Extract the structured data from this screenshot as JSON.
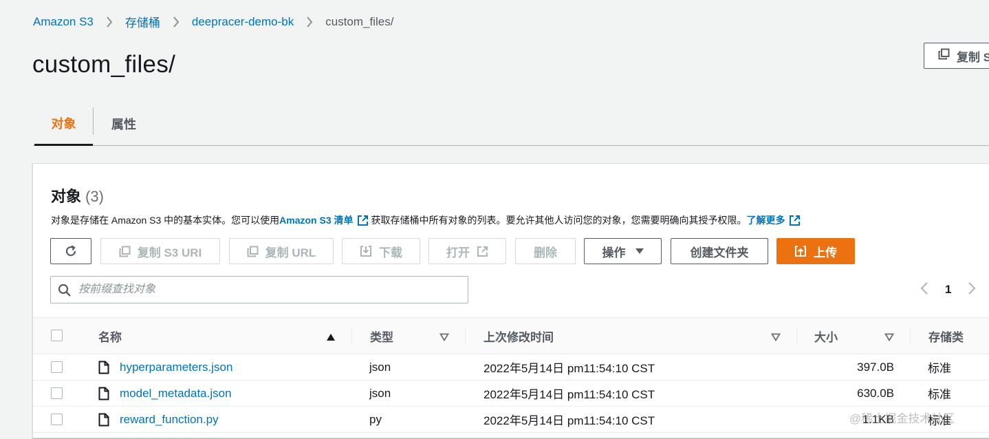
{
  "breadcrumb": {
    "items": [
      "Amazon S3",
      "存储桶",
      "deepracer-demo-bk"
    ],
    "current": "custom_files/"
  },
  "page": {
    "title": "custom_files/",
    "copy_button": "复制 S"
  },
  "tabs": [
    {
      "label": "对象",
      "active": true
    },
    {
      "label": "属性",
      "active": false
    }
  ],
  "panel": {
    "title": "对象",
    "count": "(3)",
    "desc_prefix": "对象是存储在 Amazon S3 中的基本实体。您可以使用 ",
    "desc_link": "Amazon S3 清单",
    "desc_middle": "获取存储桶中所有对象的列表。要允许其他人访问您的对象，您需要明确向其授予权限。",
    "desc_learn_more": "了解更多"
  },
  "toolbar": {
    "refresh_icon": "refresh-icon",
    "copy_s3_uri": "复制 S3 URI",
    "copy_url": "复制 URL",
    "download": "下载",
    "open": "打开",
    "delete": "删除",
    "actions": "操作",
    "create_folder": "创建文件夹",
    "upload": "上传"
  },
  "search": {
    "placeholder": "按前缀查找对象"
  },
  "pagination": {
    "page": "1"
  },
  "table": {
    "columns": {
      "name": "名称",
      "type": "类型",
      "modified": "上次修改时间",
      "size": "大小",
      "storage": "存储类"
    },
    "rows": [
      {
        "name": "hyperparameters.json",
        "type": "json",
        "modified": "2022年5月14日 pm11:54:10 CST",
        "size": "397.0B",
        "storage": "标准"
      },
      {
        "name": "model_metadata.json",
        "type": "json",
        "modified": "2022年5月14日 pm11:54:10 CST",
        "size": "630.0B",
        "storage": "标准"
      },
      {
        "name": "reward_function.py",
        "type": "py",
        "modified": "2022年5月14日 pm11:54:10 CST",
        "size": "1.1KB",
        "storage": "标准"
      }
    ]
  },
  "watermark": "@稀土掘金技术社区",
  "colors": {
    "link": "#0073bb",
    "accent": "#ec7211",
    "background": "#f2f3f3"
  }
}
